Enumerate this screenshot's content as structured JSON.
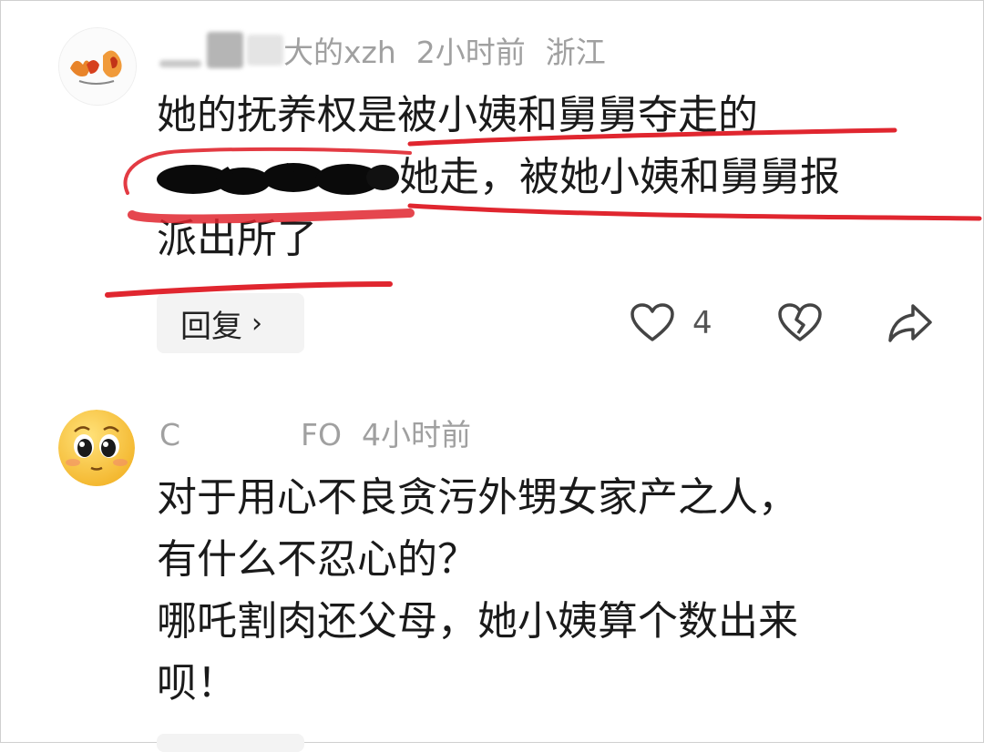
{
  "comments": [
    {
      "username_visible": "大的xzh",
      "time": "2小时前",
      "location": "浙江",
      "lines": [
        "她的抚养权是被小姨和舅舅夺走的",
        "她走，被她小姨和舅舅报",
        "派出所了"
      ],
      "reply_label": "回复",
      "likes": "4"
    },
    {
      "username_visible": "C　　　　FO",
      "time": "4小时前",
      "lines": [
        "对于用心不良贪污外甥女家产之人，",
        "有什么不忍心的？",
        "哪吒割肉还父母，她小姨算个数出来",
        "呗！"
      ]
    }
  ],
  "icons": {
    "reply_chevron": "chevron-right-icon",
    "like": "heart-icon",
    "dislike": "broken-heart-icon",
    "share": "share-arrow-icon"
  },
  "colors": {
    "underline": "#e0262f",
    "meta_text": "#a0a0a0",
    "body_text": "#1a1a1a"
  }
}
